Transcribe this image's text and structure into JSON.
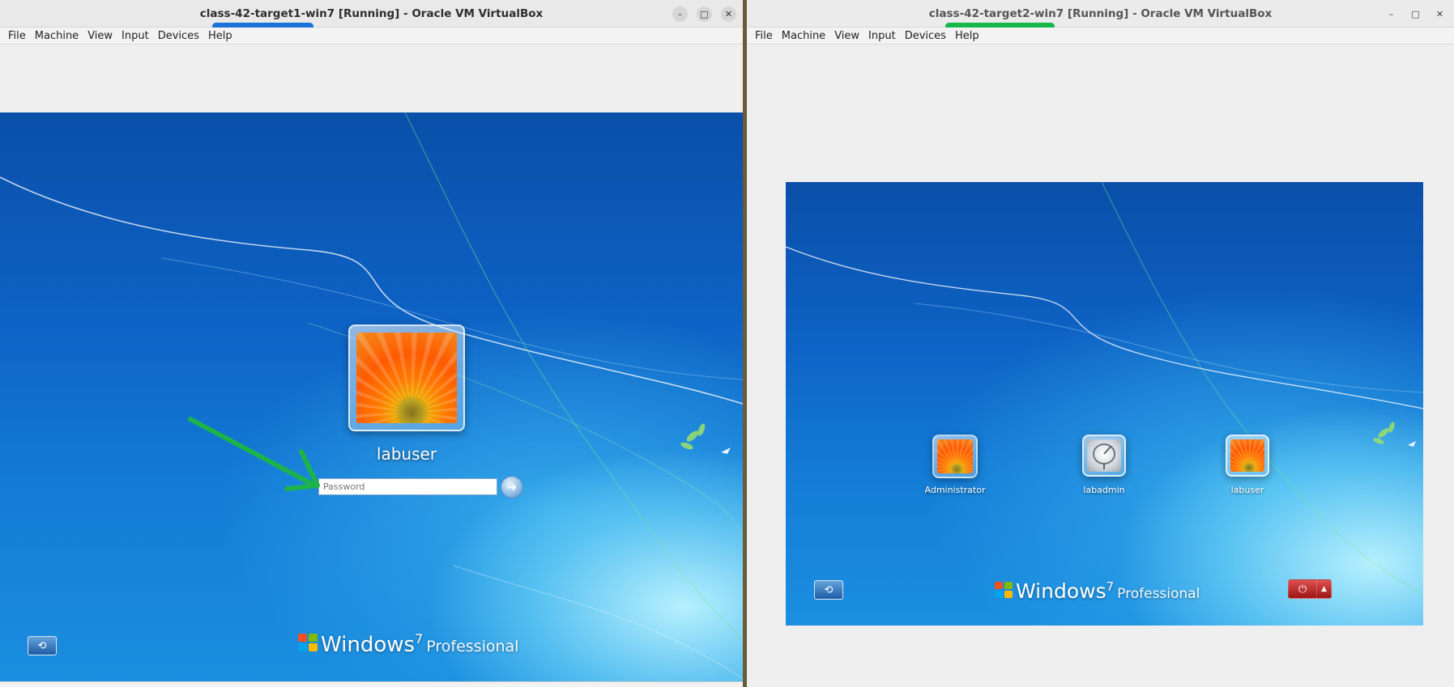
{
  "windows": [
    {
      "title": "class-42-target1-win7 [Running] - Oracle VM VirtualBox",
      "menu": [
        "File",
        "Machine",
        "View",
        "Input",
        "Devices",
        "Help"
      ],
      "controls": {
        "minimize": "–",
        "maximize": "□",
        "close": "✕"
      },
      "guest": {
        "user": "labuser",
        "password_placeholder": "Password",
        "brand": {
          "word": "Windows",
          "version": "7",
          "edition": "Professional"
        }
      }
    },
    {
      "title": "class-42-target2-win7 [Running] - Oracle VM VirtualBox",
      "menu": [
        "File",
        "Machine",
        "View",
        "Input",
        "Devices",
        "Help"
      ],
      "controls": {
        "minimize": "–",
        "maximize": "□",
        "close": "✕"
      },
      "guest": {
        "users": [
          {
            "name": "Administrator",
            "picture": "flower"
          },
          {
            "name": "labadmin",
            "picture": "satellite-dish"
          },
          {
            "name": "labuser",
            "picture": "flower"
          }
        ],
        "brand": {
          "word": "Windows",
          "version": "7",
          "edition": "Professional"
        }
      }
    }
  ],
  "annotations": {
    "title1_underline_color": "#1a73d9",
    "title2_underline_color": "#17b84b",
    "pointer_arrow_color": "#1bb34a"
  },
  "icons": {
    "ease_of_access": "ease-of-access-icon",
    "submit": "arrow-right-icon",
    "power": "power-icon"
  }
}
